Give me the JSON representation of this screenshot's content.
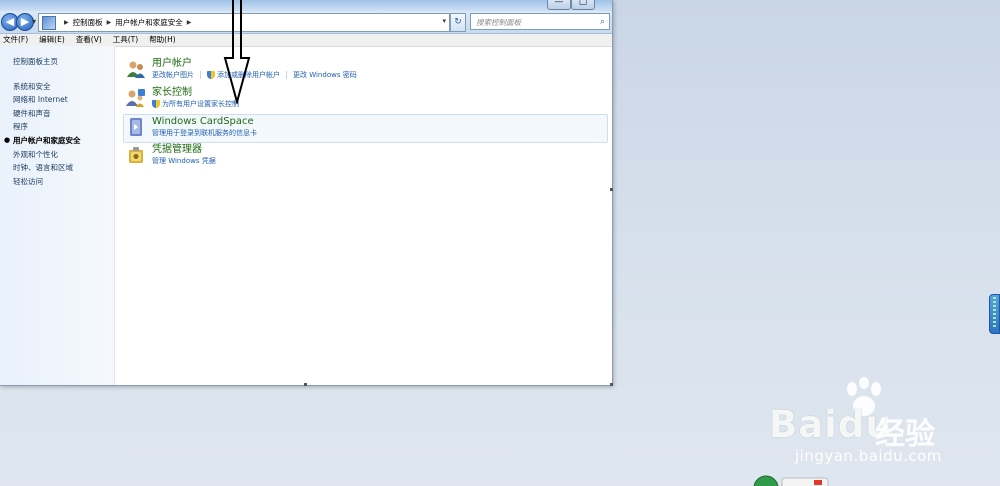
{
  "window": {
    "caption_buttons": [
      "—",
      "▢"
    ]
  },
  "address_bar": {
    "crumbs": [
      "控制面板",
      "用户帐户和家庭安全"
    ],
    "search_placeholder": "搜索控制面板"
  },
  "menu": [
    "文件(F)",
    "编辑(E)",
    "查看(V)",
    "工具(T)",
    "帮助(H)"
  ],
  "sidebar": {
    "home": "控制面板主页",
    "items": [
      "系统和安全",
      "网络和 Internet",
      "硬件和声音",
      "程序",
      "用户帐户和家庭安全",
      "外观和个性化",
      "时钟、语言和区域",
      "轻松访问"
    ],
    "active_index": 4
  },
  "categories": [
    {
      "title": "用户帐户",
      "icon": "users-icon",
      "links": [
        "更改帐户图片",
        "添加或删除用户帐户",
        "更改 Windows 密码"
      ]
    },
    {
      "title": "家长控制",
      "icon": "parental-control-icon",
      "links": [
        "为所有用户设置家长控制"
      ]
    },
    {
      "title": "Windows CardSpace",
      "icon": "cardspace-icon",
      "links": [
        "管理用于登录到联机服务的信息卡"
      ]
    },
    {
      "title": "凭据管理器",
      "icon": "credential-manager-icon",
      "links": [
        "管理 Windows 凭据"
      ]
    }
  ],
  "watermark": {
    "brand": "Bai",
    "brand2": "du",
    "cn": "经验",
    "url": "jingyan.baidu.com"
  },
  "colors": {
    "link": "#1f5fb4",
    "category_title": "#1e6b12",
    "desktop": "#d6e0ec"
  }
}
